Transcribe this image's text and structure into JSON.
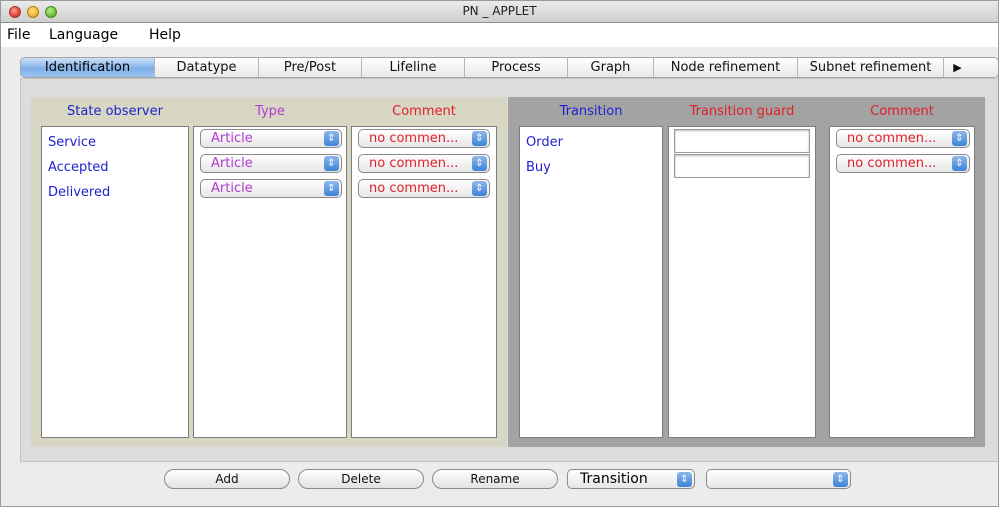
{
  "window": {
    "title": "PN _ APPLET"
  },
  "menu": [
    "File",
    "Language",
    "Help"
  ],
  "tabs": [
    "Identification",
    "Datatype",
    "Pre/Post",
    "Lifeline",
    "Process",
    "Graph",
    "Node refinement",
    "Subnet refinement"
  ],
  "tab_more_glyph": "▶",
  "active_tab": "Identification",
  "left": {
    "headers": {
      "state": "State observer",
      "type": "Type",
      "comment": "Comment"
    },
    "states": [
      "Service",
      "Accepted",
      "Delivered"
    ],
    "types": [
      "Article",
      "Article",
      "Article"
    ],
    "comments": [
      "no commen...",
      "no commen...",
      "no commen..."
    ]
  },
  "right": {
    "headers": {
      "transition": "Transition",
      "guard": "Transition guard",
      "comment": "Comment"
    },
    "transitions": [
      "Order",
      "Buy"
    ],
    "guards": [
      "",
      ""
    ],
    "comments": [
      "no commen...",
      "no commen..."
    ]
  },
  "bottom": {
    "add": "Add",
    "delete": "Delete",
    "rename": "Rename",
    "kind_select": "Transition",
    "second_select": ""
  },
  "icons": {
    "combo_arrow": "⇕"
  },
  "colors": {
    "blue": "#1f1fcf",
    "purple": "#b03ad0",
    "red": "#e0202a",
    "selected_tab": "#7fb0e9"
  }
}
